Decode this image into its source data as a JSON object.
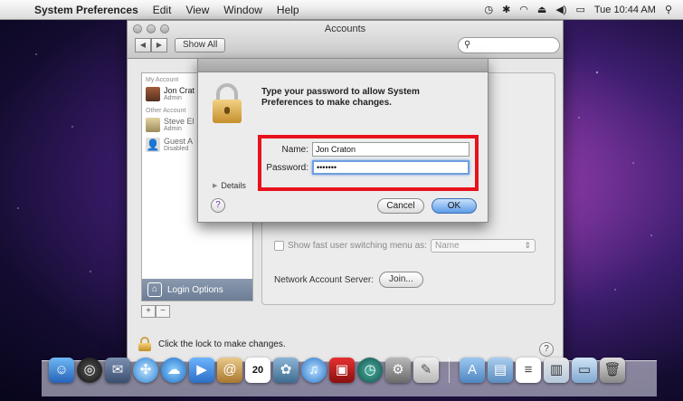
{
  "menubar": {
    "apple_glyph": "",
    "app_name": "System Preferences",
    "items": [
      "Edit",
      "View",
      "Window",
      "Help"
    ],
    "clock": "Tue 10:44 AM"
  },
  "window": {
    "title": "Accounts",
    "show_all": "Show All",
    "search_value": ""
  },
  "accounts": {
    "my_account_header": "My Account",
    "my_account": {
      "name": "Jon Crat",
      "role": "Admin"
    },
    "other_header": "Other Account",
    "others": [
      {
        "name": "Steve El",
        "role": "Admin"
      },
      {
        "name": "Guest A",
        "role": "Disabled"
      }
    ],
    "login_options": "Login Options",
    "add_label": "+",
    "remove_label": "−"
  },
  "right": {
    "fast_user_switching": "Show fast user switching menu as:",
    "fus_value": "Name",
    "network_server_label": "Network Account Server:",
    "join_label": "Join..."
  },
  "footer": {
    "lock_text": "Click the lock to make changes.",
    "help_label": "?"
  },
  "dialog": {
    "prompt": "Type your password to allow System Preferences to make changes.",
    "name_label": "Name:",
    "name_value": "Jon Craton",
    "password_label": "Password:",
    "password_value": "•••••••",
    "details_label": "Details",
    "help_label": "?",
    "cancel_label": "Cancel",
    "ok_label": "OK"
  },
  "dock": {
    "calendar_day": "20",
    "items": [
      "finder-icon",
      "dashboard-icon",
      "mail-stamp-icon",
      "safari-icon",
      "ichat-icon",
      "facetime-icon",
      "address-book-icon",
      "ical-icon",
      "iphoto-icon",
      "itunes-icon",
      "photo-booth-icon",
      "time-machine-icon",
      "system-preferences-icon",
      "preview-icon"
    ]
  },
  "colors": {
    "highlight_box": "#e8121d",
    "ok_button": "#5d9ce8"
  }
}
